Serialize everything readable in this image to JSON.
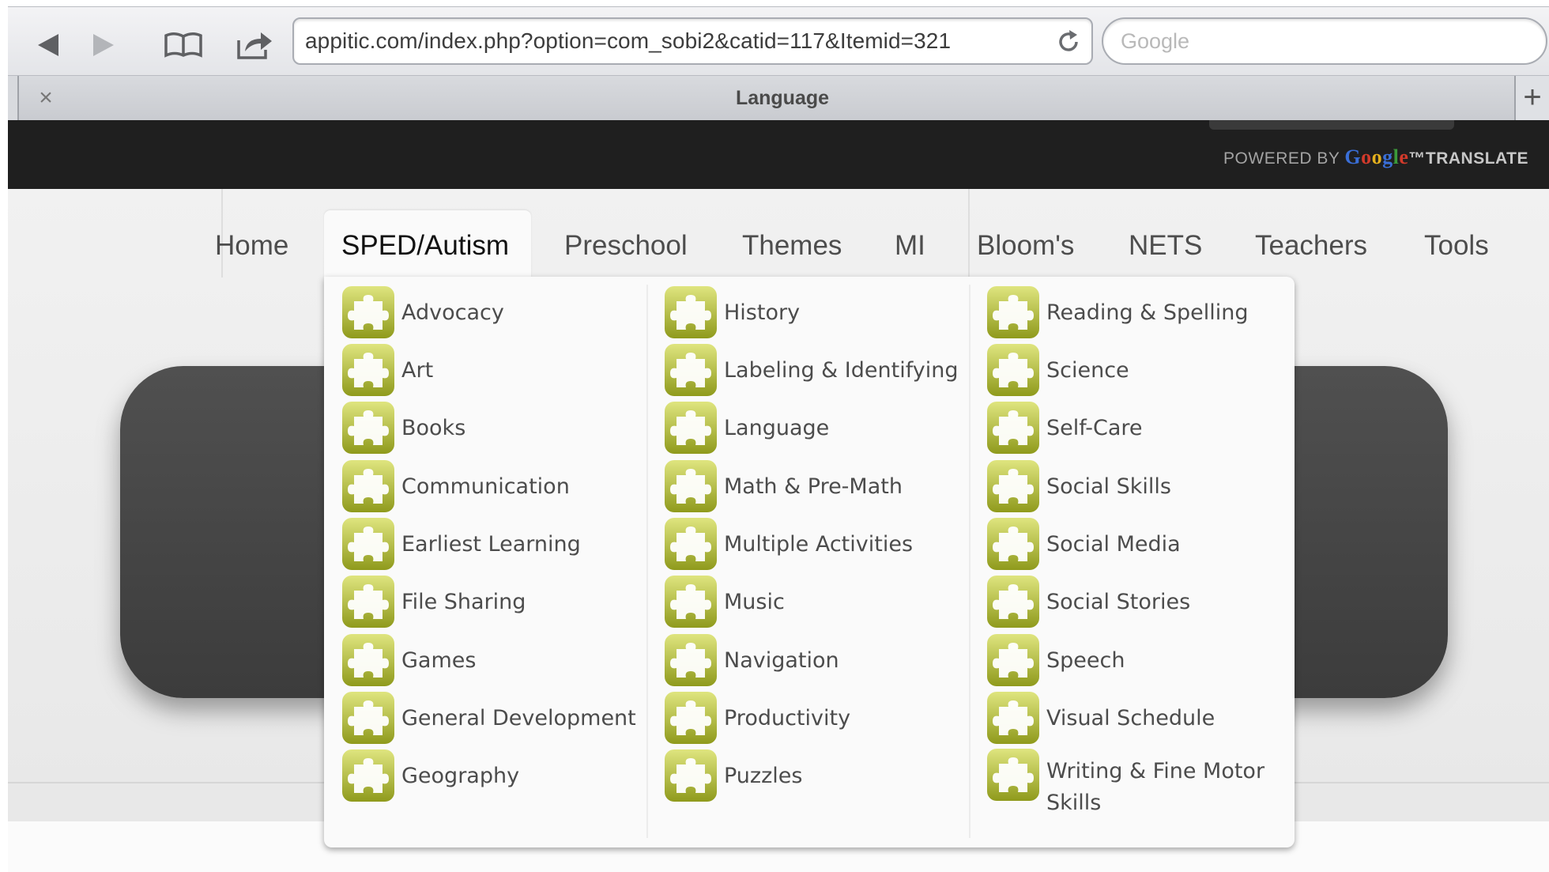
{
  "browser": {
    "url": "appitic.com/index.php?option=com_sobi2&catid=117&Itemid=321",
    "search_placeholder": "Google",
    "tab_title": "Language",
    "tab_close": "×",
    "tab_add": "+"
  },
  "translate": {
    "powered_by": "POWERED BY",
    "google": "Google",
    "tm": "™",
    "translate": "TRANSLATE"
  },
  "menu": {
    "items": [
      "Home",
      "SPED/Autism",
      "Preschool",
      "Themes",
      "MI",
      "Bloom's",
      "NETS",
      "Teachers",
      "Tools"
    ],
    "active": "SPED/Autism"
  },
  "categories": {
    "col1": [
      "Advocacy",
      "Art",
      "Books",
      "Communication",
      "Earliest Learning",
      "File Sharing",
      "Games",
      "General Development",
      "Geography"
    ],
    "col2": [
      "History",
      "Labeling & Identifying",
      "Language",
      "Math & Pre-Math",
      "Multiple Activities",
      "Music",
      "Navigation",
      "Productivity",
      "Puzzles"
    ],
    "col3": [
      "Reading & Spelling",
      "Science",
      "Self-Care",
      "Social Skills",
      "Social Media",
      "Social Stories",
      "Speech",
      "Visual Schedule",
      "Writing & Fine Motor Skills"
    ]
  },
  "icon": "puzzle-piece-icon",
  "colors": {
    "icon_green_light": "#d5dc6a",
    "icon_green_dark": "#8f9a1c",
    "top_band": "#1f1f1f"
  }
}
